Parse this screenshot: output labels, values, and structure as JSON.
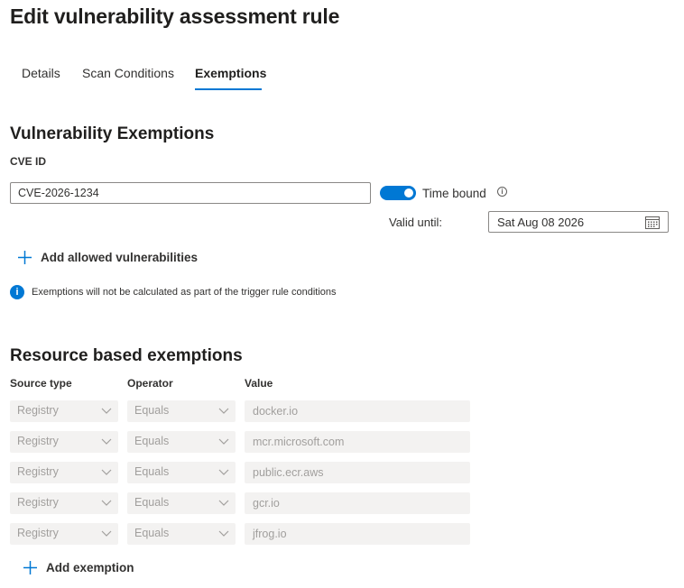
{
  "header": {
    "title": "Edit vulnerability assessment rule"
  },
  "tabs": [
    {
      "label": "Details",
      "active": false
    },
    {
      "label": "Scan Conditions",
      "active": false
    },
    {
      "label": "Exemptions",
      "active": true
    }
  ],
  "vuln": {
    "title": "Vulnerability Exemptions",
    "cve_label": "CVE ID",
    "cve_value": "CVE-2026-1234",
    "time_bound_label": "Time bound",
    "time_bound_on": true,
    "info_icon": "i",
    "valid_until_label": "Valid until:",
    "valid_until_value": "Sat Aug 08 2026",
    "add_label": "Add allowed vulnerabilities",
    "info_text": "Exemptions will not be calculated as part of the trigger rule conditions",
    "info_glyph": "i"
  },
  "resource": {
    "title": "Resource based exemptions",
    "headers": {
      "source_type": "Source type",
      "operator": "Operator",
      "value": "Value"
    },
    "rows": [
      {
        "source_type": "Registry",
        "operator": "Equals",
        "value": "docker.io"
      },
      {
        "source_type": "Registry",
        "operator": "Equals",
        "value": "mcr.microsoft.com"
      },
      {
        "source_type": "Registry",
        "operator": "Equals",
        "value": "public.ecr.aws"
      },
      {
        "source_type": "Registry",
        "operator": "Equals",
        "value": "gcr.io"
      },
      {
        "source_type": "Registry",
        "operator": "Equals",
        "value": "jfrog.io"
      }
    ],
    "add_label": "Add exemption"
  },
  "colors": {
    "accent": "#0078d4",
    "disabled_bg": "#f3f2f1",
    "disabled_text": "#a19f9d"
  }
}
